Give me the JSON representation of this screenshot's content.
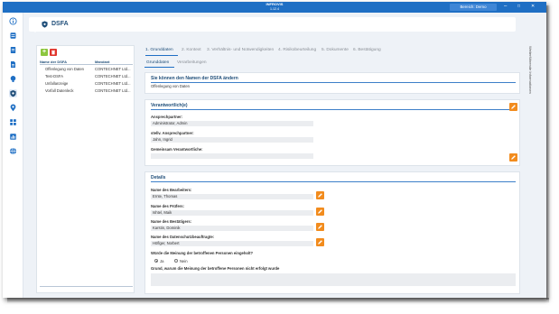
{
  "window": {
    "app_title": "INFROVIS",
    "app_version": "1.12.4",
    "area_button": "Bereich: Demo",
    "minimize": "–",
    "maximize": "□",
    "close": "✕"
  },
  "rail": {
    "icons": [
      "info-icon",
      "database-icon",
      "document-icon",
      "file-icon",
      "lightbulb-icon",
      "shield-icon",
      "location-icon",
      "grid-icon",
      "chart-icon",
      "globe-icon"
    ],
    "active_index": 5
  },
  "header": {
    "title": "DSFA"
  },
  "list": {
    "columns": [
      "Name der DSFA",
      "Mandant"
    ],
    "rows": [
      {
        "name": "Offenlegung von Daten",
        "mandant": "CONTECHNET Ltd..."
      },
      {
        "name": "Test-DSFA",
        "mandant": "CONTECHNET Ltd..."
      },
      {
        "name": "Unfallanzeige",
        "mandant": "CONTECHNET Ltd..."
      },
      {
        "name": "Vorfall Datenleck",
        "mandant": "CONTECHNET Ltd..."
      }
    ]
  },
  "steps": [
    {
      "label": "1. Grunddaten",
      "active": true
    },
    {
      "label": "2. Kontext",
      "active": false
    },
    {
      "label": "3. Verhältnis- und Notwendigkeiten",
      "active": false
    },
    {
      "label": "4. Risikobeurteilung",
      "active": false
    },
    {
      "label": "5. Dokumente",
      "active": false
    },
    {
      "label": "6. Bestätigung",
      "active": false
    }
  ],
  "subtabs": [
    {
      "label": "Grunddaten",
      "active": true
    },
    {
      "label": "Verarbeitungen",
      "active": false
    }
  ],
  "right_panel": {
    "vertical_label": "Weiterführende Informationen",
    "toggle_label": "⊟"
  },
  "name_card": {
    "title": "Sie können den Namen der DSFA ändern",
    "value": "Offenlegung von Daten"
  },
  "responsible_card": {
    "title": "Verantwortlich(e)",
    "contact_label": "Ansprechpartner:",
    "contact_value": "Administrator, Admin",
    "deputy_label": "stellv. Ansprechpartner:",
    "deputy_value": "Jahn, Ingrid",
    "joint_label": "Gemeinsam Verantwortliche:",
    "joint_value": ""
  },
  "details_card": {
    "title": "Details",
    "editor_label": "Name des Bearbeiters:",
    "editor_value": "Ernte, Thomas",
    "reviewer_label": "Name des Prüfers:",
    "reviewer_value": "Ishtel, Maik",
    "approver_label": "Name des Bestätigers:",
    "approver_value": "Karstin, Dominik",
    "dpo_label": "Name des Datenschutzbeauftragte:",
    "dpo_value": "Höflger, Norbert",
    "opinion_question": "Würde die Meinung der betroffenen Personen eingeholt?",
    "opinion_yes": "Ja",
    "opinion_no": "Nein",
    "opinion_selected": "yes",
    "reason_label": "Grund, warum die Meinung der betroffene Personen nicht erfolgt wurde",
    "reason_value": ""
  },
  "colors": {
    "titlebar": "#1f6fc4",
    "accent": "#1f4e79",
    "edit": "#f28c1e",
    "add": "#8cc63f",
    "delete": "#e0342b"
  }
}
